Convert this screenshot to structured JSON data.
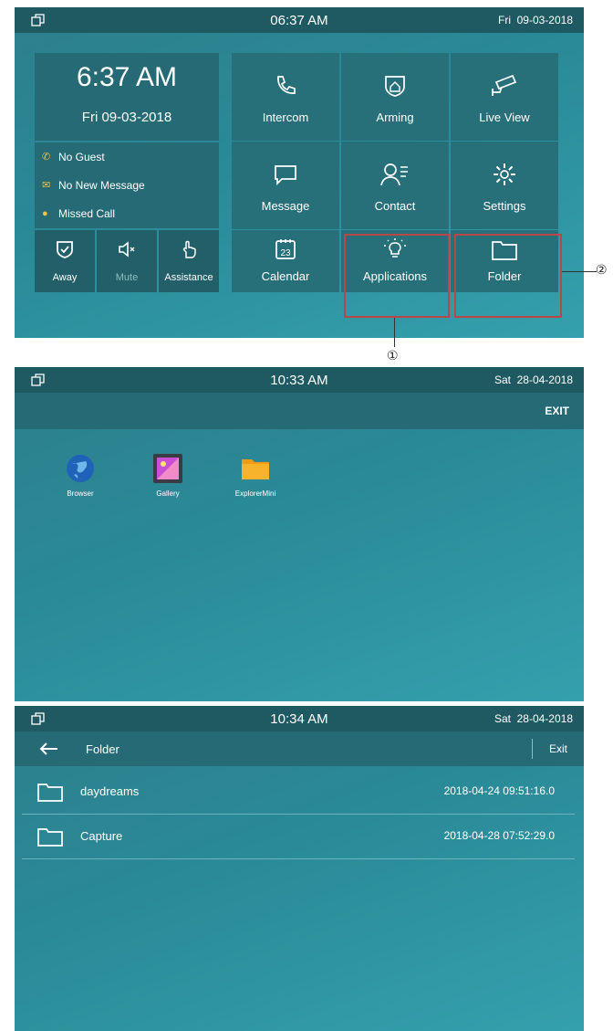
{
  "screen1": {
    "status": {
      "time": "06:37 AM",
      "day": "Fri",
      "date": "09-03-2018"
    },
    "clock": {
      "time": "6:37 AM",
      "date": "Fri 09-03-2018"
    },
    "notifications": [
      "No Guest",
      "No New Message",
      "Missed Call"
    ],
    "quick_actions": [
      {
        "label": "Away",
        "icon": "shield-check-icon"
      },
      {
        "label": "Mute",
        "icon": "speaker-mute-icon"
      },
      {
        "label": "Assistance",
        "icon": "hand-tap-icon"
      }
    ],
    "tiles": [
      {
        "label": "Intercom",
        "icon": "phone-icon"
      },
      {
        "label": "Arming",
        "icon": "home-shield-icon"
      },
      {
        "label": "Live View",
        "icon": "camera-icon"
      },
      {
        "label": "Message",
        "icon": "message-icon"
      },
      {
        "label": "Contact",
        "icon": "contact-icon"
      },
      {
        "label": "Settings",
        "icon": "gear-icon"
      },
      {
        "label": "Calendar",
        "icon": "calendar-icon"
      },
      {
        "label": "Applications",
        "icon": "lightbulb-icon"
      },
      {
        "label": "Folder",
        "icon": "folder-icon"
      }
    ],
    "calendar_day": "23",
    "callouts": {
      "one": "①",
      "two": "②"
    }
  },
  "screen2": {
    "status": {
      "time": "10:33 AM",
      "day": "Sat",
      "date": "28-04-2018"
    },
    "exit_label": "EXIT",
    "apps": [
      {
        "label": "Browser",
        "icon": "globe-icon"
      },
      {
        "label": "Gallery",
        "icon": "gallery-icon"
      },
      {
        "label": "ExplorerMini",
        "icon": "folder-icon"
      }
    ]
  },
  "screen3": {
    "status": {
      "time": "10:34 AM",
      "day": "Sat",
      "date": "28-04-2018"
    },
    "title": "Folder",
    "exit_label": "Exit",
    "back_icon": "arrow-left-icon",
    "folders": [
      {
        "name": "daydreams",
        "timestamp": "2018-04-24 09:51:16.0"
      },
      {
        "name": "Capture",
        "timestamp": "2018-04-28 07:52:29.0"
      }
    ]
  },
  "colors": {
    "statusbar": "#1f5961",
    "tile": "#276f79",
    "highlight": "#b84848",
    "accent": "#f0c04a"
  }
}
